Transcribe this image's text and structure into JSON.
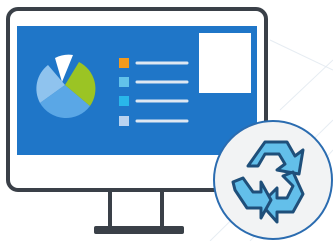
{
  "illustration": {
    "subject": "monitor-dashboard-with-recycle-badge",
    "colors": {
      "screen": "#1f76c8",
      "bezel": "#3a4048",
      "pie_light_blue": "#8fc3ee",
      "pie_mid_blue": "#5aa7e6",
      "pie_green": "#9bc424",
      "pie_white": "#ffffff",
      "legend_orange": "#f39a1d",
      "legend_sky": "#62c2ea",
      "legend_cyan": "#29b7ea",
      "legend_pale": "#b9d3f0",
      "badge_bg": "#f2f3f4",
      "recycle_fill": "#63bfea",
      "recycle_outline": "#1f4f7a"
    },
    "icons": [
      "pie-chart-icon",
      "recycle-icon"
    ],
    "legend_item_count": 4,
    "pie_slices": [
      "light-blue",
      "mid-blue",
      "green",
      "white"
    ]
  }
}
